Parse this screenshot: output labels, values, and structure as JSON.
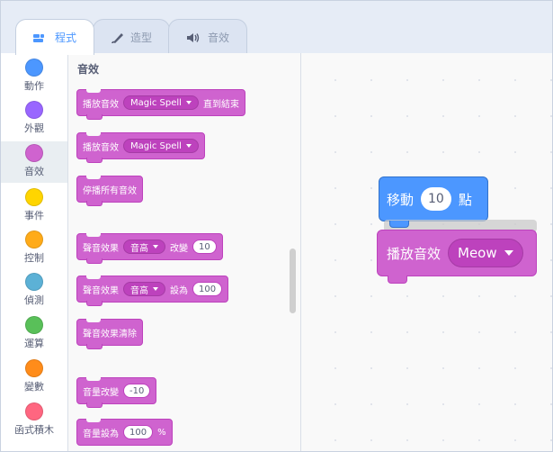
{
  "tabs": [
    {
      "label": "程式",
      "icon": "code-icon",
      "active": true
    },
    {
      "label": "造型",
      "icon": "brush-icon",
      "active": false
    },
    {
      "label": "音效",
      "icon": "speaker-icon",
      "active": false
    }
  ],
  "categories": [
    {
      "label": "動作",
      "color": "#4c97ff"
    },
    {
      "label": "外觀",
      "color": "#9966ff"
    },
    {
      "label": "音效",
      "color": "#cf63cf",
      "selected": true
    },
    {
      "label": "事件",
      "color": "#ffd500"
    },
    {
      "label": "控制",
      "color": "#ffab19"
    },
    {
      "label": "偵測",
      "color": "#5cb1d6"
    },
    {
      "label": "運算",
      "color": "#59c059"
    },
    {
      "label": "變數",
      "color": "#ff8c1a"
    },
    {
      "label": "函式積木",
      "color": "#ff6680"
    }
  ],
  "palette": {
    "heading": "音效",
    "play_until_done": {
      "prefix": "播放音效",
      "sound": "Magic Spell",
      "suffix": "直到結束"
    },
    "play": {
      "prefix": "播放音效",
      "sound": "Magic Spell"
    },
    "stop_all": "停播所有音效",
    "change_effect": {
      "prefix": "聲音效果",
      "effect": "音高",
      "middle": "改變",
      "value": "10"
    },
    "set_effect": {
      "prefix": "聲音效果",
      "effect": "音高",
      "middle": "設為",
      "value": "100"
    },
    "clear_effects": "聲音效果清除",
    "change_volume": {
      "prefix": "音量改變",
      "value": "-10"
    },
    "set_volume": {
      "prefix": "音量設為",
      "value": "100",
      "suffix": "%"
    }
  },
  "workspace": {
    "motion_block": {
      "prefix": "移動",
      "value": "10",
      "suffix": "點"
    },
    "sound_block": {
      "prefix": "播放音效",
      "sound": "Meow"
    }
  },
  "colors": {
    "sound": "#cf63cf",
    "motion": "#4c97ff",
    "accent": "#4c97ff"
  }
}
